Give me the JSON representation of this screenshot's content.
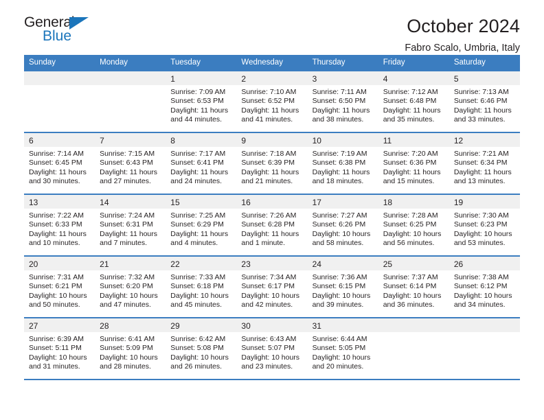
{
  "logo": {
    "word1": "General",
    "word2": "Blue",
    "triangle_color": "#1b75bb",
    "icon": "general-blue-logo"
  },
  "header": {
    "title": "October 2024",
    "subtitle": "Fabro Scalo, Umbria, Italy"
  },
  "colors": {
    "header_blue": "#3b7dc0",
    "daynum_band": "#f0f0f0",
    "text": "#231f20",
    "logo_blue": "#1b75bb"
  },
  "weekday_headers": [
    "Sunday",
    "Monday",
    "Tuesday",
    "Wednesday",
    "Thursday",
    "Friday",
    "Saturday"
  ],
  "weeks": [
    [
      {
        "day": "",
        "sunrise": "",
        "sunset": "",
        "daylight1": "",
        "daylight2": ""
      },
      {
        "day": "",
        "sunrise": "",
        "sunset": "",
        "daylight1": "",
        "daylight2": ""
      },
      {
        "day": "1",
        "sunrise": "Sunrise: 7:09 AM",
        "sunset": "Sunset: 6:53 PM",
        "daylight1": "Daylight: 11 hours",
        "daylight2": "and 44 minutes."
      },
      {
        "day": "2",
        "sunrise": "Sunrise: 7:10 AM",
        "sunset": "Sunset: 6:52 PM",
        "daylight1": "Daylight: 11 hours",
        "daylight2": "and 41 minutes."
      },
      {
        "day": "3",
        "sunrise": "Sunrise: 7:11 AM",
        "sunset": "Sunset: 6:50 PM",
        "daylight1": "Daylight: 11 hours",
        "daylight2": "and 38 minutes."
      },
      {
        "day": "4",
        "sunrise": "Sunrise: 7:12 AM",
        "sunset": "Sunset: 6:48 PM",
        "daylight1": "Daylight: 11 hours",
        "daylight2": "and 35 minutes."
      },
      {
        "day": "5",
        "sunrise": "Sunrise: 7:13 AM",
        "sunset": "Sunset: 6:46 PM",
        "daylight1": "Daylight: 11 hours",
        "daylight2": "and 33 minutes."
      }
    ],
    [
      {
        "day": "6",
        "sunrise": "Sunrise: 7:14 AM",
        "sunset": "Sunset: 6:45 PM",
        "daylight1": "Daylight: 11 hours",
        "daylight2": "and 30 minutes."
      },
      {
        "day": "7",
        "sunrise": "Sunrise: 7:15 AM",
        "sunset": "Sunset: 6:43 PM",
        "daylight1": "Daylight: 11 hours",
        "daylight2": "and 27 minutes."
      },
      {
        "day": "8",
        "sunrise": "Sunrise: 7:17 AM",
        "sunset": "Sunset: 6:41 PM",
        "daylight1": "Daylight: 11 hours",
        "daylight2": "and 24 minutes."
      },
      {
        "day": "9",
        "sunrise": "Sunrise: 7:18 AM",
        "sunset": "Sunset: 6:39 PM",
        "daylight1": "Daylight: 11 hours",
        "daylight2": "and 21 minutes."
      },
      {
        "day": "10",
        "sunrise": "Sunrise: 7:19 AM",
        "sunset": "Sunset: 6:38 PM",
        "daylight1": "Daylight: 11 hours",
        "daylight2": "and 18 minutes."
      },
      {
        "day": "11",
        "sunrise": "Sunrise: 7:20 AM",
        "sunset": "Sunset: 6:36 PM",
        "daylight1": "Daylight: 11 hours",
        "daylight2": "and 15 minutes."
      },
      {
        "day": "12",
        "sunrise": "Sunrise: 7:21 AM",
        "sunset": "Sunset: 6:34 PM",
        "daylight1": "Daylight: 11 hours",
        "daylight2": "and 13 minutes."
      }
    ],
    [
      {
        "day": "13",
        "sunrise": "Sunrise: 7:22 AM",
        "sunset": "Sunset: 6:33 PM",
        "daylight1": "Daylight: 11 hours",
        "daylight2": "and 10 minutes."
      },
      {
        "day": "14",
        "sunrise": "Sunrise: 7:24 AM",
        "sunset": "Sunset: 6:31 PM",
        "daylight1": "Daylight: 11 hours",
        "daylight2": "and 7 minutes."
      },
      {
        "day": "15",
        "sunrise": "Sunrise: 7:25 AM",
        "sunset": "Sunset: 6:29 PM",
        "daylight1": "Daylight: 11 hours",
        "daylight2": "and 4 minutes."
      },
      {
        "day": "16",
        "sunrise": "Sunrise: 7:26 AM",
        "sunset": "Sunset: 6:28 PM",
        "daylight1": "Daylight: 11 hours",
        "daylight2": "and 1 minute."
      },
      {
        "day": "17",
        "sunrise": "Sunrise: 7:27 AM",
        "sunset": "Sunset: 6:26 PM",
        "daylight1": "Daylight: 10 hours",
        "daylight2": "and 58 minutes."
      },
      {
        "day": "18",
        "sunrise": "Sunrise: 7:28 AM",
        "sunset": "Sunset: 6:25 PM",
        "daylight1": "Daylight: 10 hours",
        "daylight2": "and 56 minutes."
      },
      {
        "day": "19",
        "sunrise": "Sunrise: 7:30 AM",
        "sunset": "Sunset: 6:23 PM",
        "daylight1": "Daylight: 10 hours",
        "daylight2": "and 53 minutes."
      }
    ],
    [
      {
        "day": "20",
        "sunrise": "Sunrise: 7:31 AM",
        "sunset": "Sunset: 6:21 PM",
        "daylight1": "Daylight: 10 hours",
        "daylight2": "and 50 minutes."
      },
      {
        "day": "21",
        "sunrise": "Sunrise: 7:32 AM",
        "sunset": "Sunset: 6:20 PM",
        "daylight1": "Daylight: 10 hours",
        "daylight2": "and 47 minutes."
      },
      {
        "day": "22",
        "sunrise": "Sunrise: 7:33 AM",
        "sunset": "Sunset: 6:18 PM",
        "daylight1": "Daylight: 10 hours",
        "daylight2": "and 45 minutes."
      },
      {
        "day": "23",
        "sunrise": "Sunrise: 7:34 AM",
        "sunset": "Sunset: 6:17 PM",
        "daylight1": "Daylight: 10 hours",
        "daylight2": "and 42 minutes."
      },
      {
        "day": "24",
        "sunrise": "Sunrise: 7:36 AM",
        "sunset": "Sunset: 6:15 PM",
        "daylight1": "Daylight: 10 hours",
        "daylight2": "and 39 minutes."
      },
      {
        "day": "25",
        "sunrise": "Sunrise: 7:37 AM",
        "sunset": "Sunset: 6:14 PM",
        "daylight1": "Daylight: 10 hours",
        "daylight2": "and 36 minutes."
      },
      {
        "day": "26",
        "sunrise": "Sunrise: 7:38 AM",
        "sunset": "Sunset: 6:12 PM",
        "daylight1": "Daylight: 10 hours",
        "daylight2": "and 34 minutes."
      }
    ],
    [
      {
        "day": "27",
        "sunrise": "Sunrise: 6:39 AM",
        "sunset": "Sunset: 5:11 PM",
        "daylight1": "Daylight: 10 hours",
        "daylight2": "and 31 minutes."
      },
      {
        "day": "28",
        "sunrise": "Sunrise: 6:41 AM",
        "sunset": "Sunset: 5:09 PM",
        "daylight1": "Daylight: 10 hours",
        "daylight2": "and 28 minutes."
      },
      {
        "day": "29",
        "sunrise": "Sunrise: 6:42 AM",
        "sunset": "Sunset: 5:08 PM",
        "daylight1": "Daylight: 10 hours",
        "daylight2": "and 26 minutes."
      },
      {
        "day": "30",
        "sunrise": "Sunrise: 6:43 AM",
        "sunset": "Sunset: 5:07 PM",
        "daylight1": "Daylight: 10 hours",
        "daylight2": "and 23 minutes."
      },
      {
        "day": "31",
        "sunrise": "Sunrise: 6:44 AM",
        "sunset": "Sunset: 5:05 PM",
        "daylight1": "Daylight: 10 hours",
        "daylight2": "and 20 minutes."
      },
      {
        "day": "",
        "sunrise": "",
        "sunset": "",
        "daylight1": "",
        "daylight2": ""
      },
      {
        "day": "",
        "sunrise": "",
        "sunset": "",
        "daylight1": "",
        "daylight2": ""
      }
    ]
  ]
}
